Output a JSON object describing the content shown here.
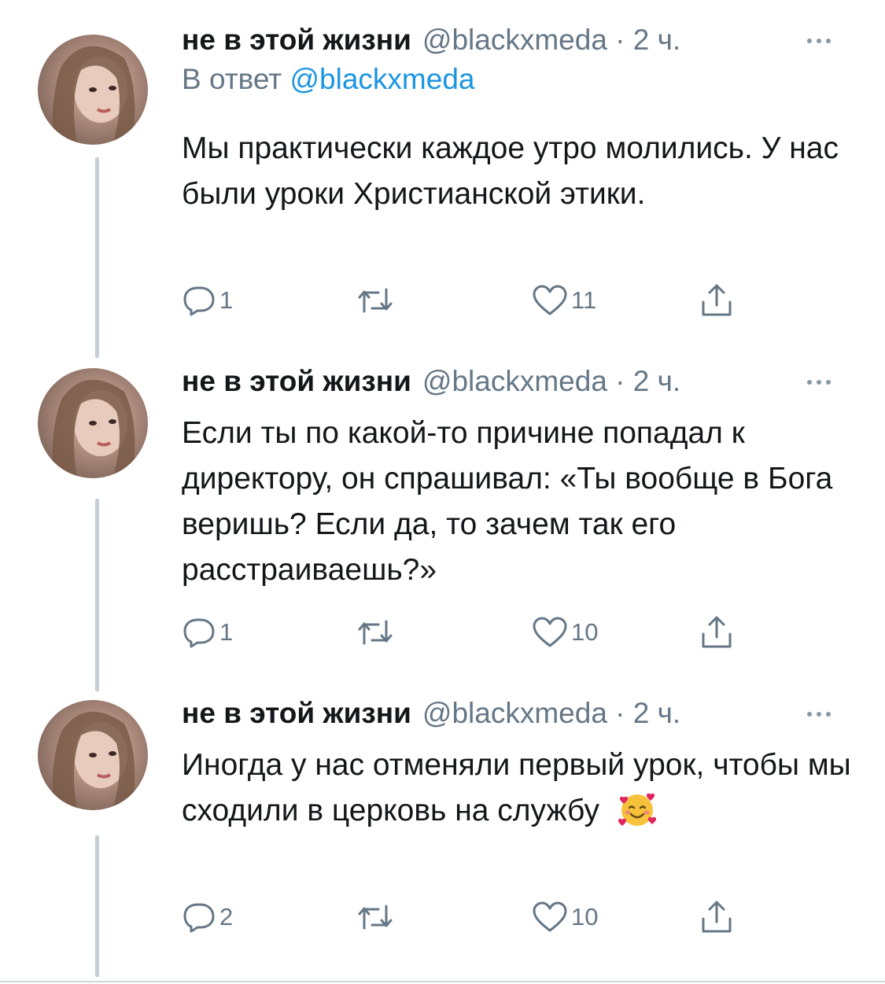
{
  "tweets": [
    {
      "name": "не в этой жизни",
      "handle_time": "@blackxmeda · 2 ч.",
      "reply_prefix": "В ответ",
      "reply_handle": "@blackxmeda",
      "text": "Мы практически каждое утро молились. У нас были уроки Христианской этики.",
      "replies": "1",
      "retweets": "",
      "likes": "11"
    },
    {
      "name": "не в этой жизни",
      "handle_time": "@blackxmeda · 2 ч.",
      "text": "Если ты по какой-то причине попадал к директору, он спрашивал: «Ты вообще в Бога веришь? Если да, то зачем так его расстраиваешь?»",
      "replies": "1",
      "retweets": "",
      "likes": "10"
    },
    {
      "name": "не в этой жизни",
      "handle_time": "@blackxmeda · 2 ч.",
      "text": "Иногда у нас отменяли первый урок, чтобы мы сходили в церковь на службу",
      "emoji": "smiling-face-with-hearts",
      "replies": "2",
      "retweets": "",
      "likes": "10"
    }
  ],
  "colors": {
    "text": "#14171a",
    "secondary": "#657786",
    "link": "#1b95e0",
    "thread_line": "#c4cfd6"
  },
  "icons": [
    "reply-icon",
    "retweet-icon",
    "like-icon",
    "share-icon",
    "more-icon"
  ]
}
